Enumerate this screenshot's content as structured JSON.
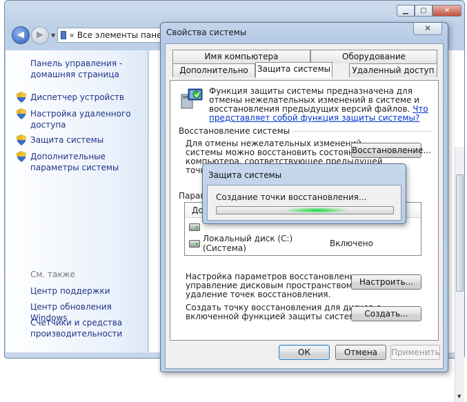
{
  "explorer": {
    "address_text": "Все элементы панел",
    "nav_chevron": "«",
    "left_pane": {
      "home_link": "Панель управления - домашняя страница",
      "items": [
        {
          "label": "Диспетчер устройств"
        },
        {
          "label": "Настройка удаленного доступа"
        },
        {
          "label": "Защита системы"
        },
        {
          "label": "Дополнительные параметры системы"
        }
      ],
      "see_also": "См. также",
      "see_also_links": [
        {
          "label": "Центр поддержки"
        },
        {
          "label": "Центр обновления Windows"
        },
        {
          "label": "Счетчики и средства производительности"
        }
      ]
    }
  },
  "dialog": {
    "title": "Свойства системы",
    "close_glyph": "✕",
    "tabs_top": [
      "Имя компьютера",
      "Оборудование"
    ],
    "tabs_bottom": [
      "Дополнительно",
      "Защита системы",
      "Удаленный доступ"
    ],
    "intro_text": "Функция защиты системы предназначена для отмены нежелательных изменений в системе и восстановления предыдущих версий файлов. ",
    "intro_link": "Что представляет собой функция защиты системы?",
    "restore_group": {
      "label": "Восстановление системы",
      "description_line1": "Для отмены нежелательных изменений",
      "description_line2": "системы можно восстановить состояние",
      "description_line3": "компьютера, соответствующее предыдущей",
      "description_line4": "точке",
      "restore_button": "Восстановление..."
    },
    "protection_group": {
      "label_partial": "Парам",
      "header_partial": "До",
      "disks": [
        {
          "name": "Локальный диск (C:) (Система)",
          "status": "Включено"
        }
      ]
    },
    "configure_text_line1": "Настройка параметров восстановления,",
    "configure_text_line2": "управление дисковым пространством и",
    "configure_text_line3": "удаление точек восстановления.",
    "configure_button": "Настроить...",
    "create_text_line1": "Создать точку восстановления для дисков с",
    "create_text_line2": "включенной функцией защиты системы.",
    "create_button": "Создать...",
    "ok_button": "ОК",
    "cancel_button": "Отмена",
    "apply_button": "Применить"
  },
  "popup": {
    "title": "Защита системы",
    "message": "Создание точки восстановления..."
  },
  "colors": {
    "link": "#1e3287",
    "progress_green": "#1fd14a"
  }
}
